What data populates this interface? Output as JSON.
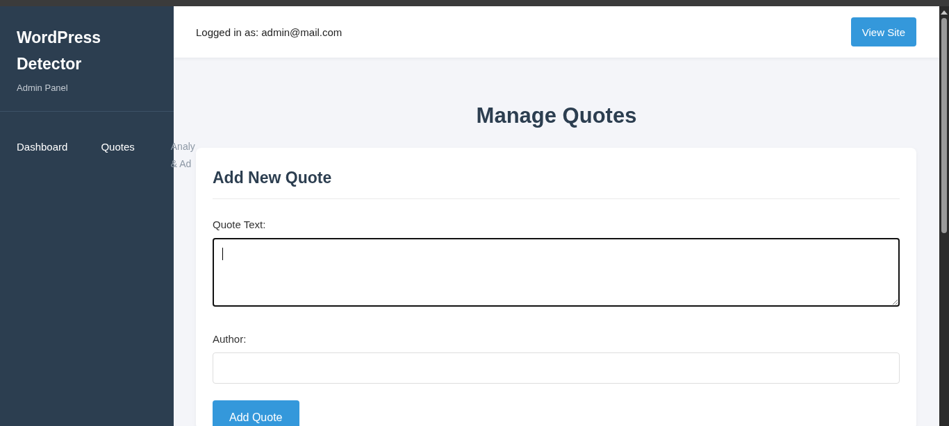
{
  "sidebar": {
    "title": "WordPress Detector",
    "subtitle": "Admin Panel",
    "items": [
      {
        "lines": [
          "Dashboard"
        ]
      },
      {
        "lines": [
          "Quotes"
        ]
      },
      {
        "lines": [
          "Analy",
          "& Ad"
        ]
      }
    ]
  },
  "header": {
    "user": "Logged in as: admin@mail.com",
    "button": "View Site"
  },
  "page_title": "Manage Quotes",
  "form": {
    "title": "Add New Quote",
    "fields": [
      {
        "kind": "textarea",
        "label": "Quote Text:",
        "focused": true
      },
      {
        "kind": "input",
        "label": "Author:",
        "focused": false
      }
    ],
    "button": "Add Quote"
  }
}
